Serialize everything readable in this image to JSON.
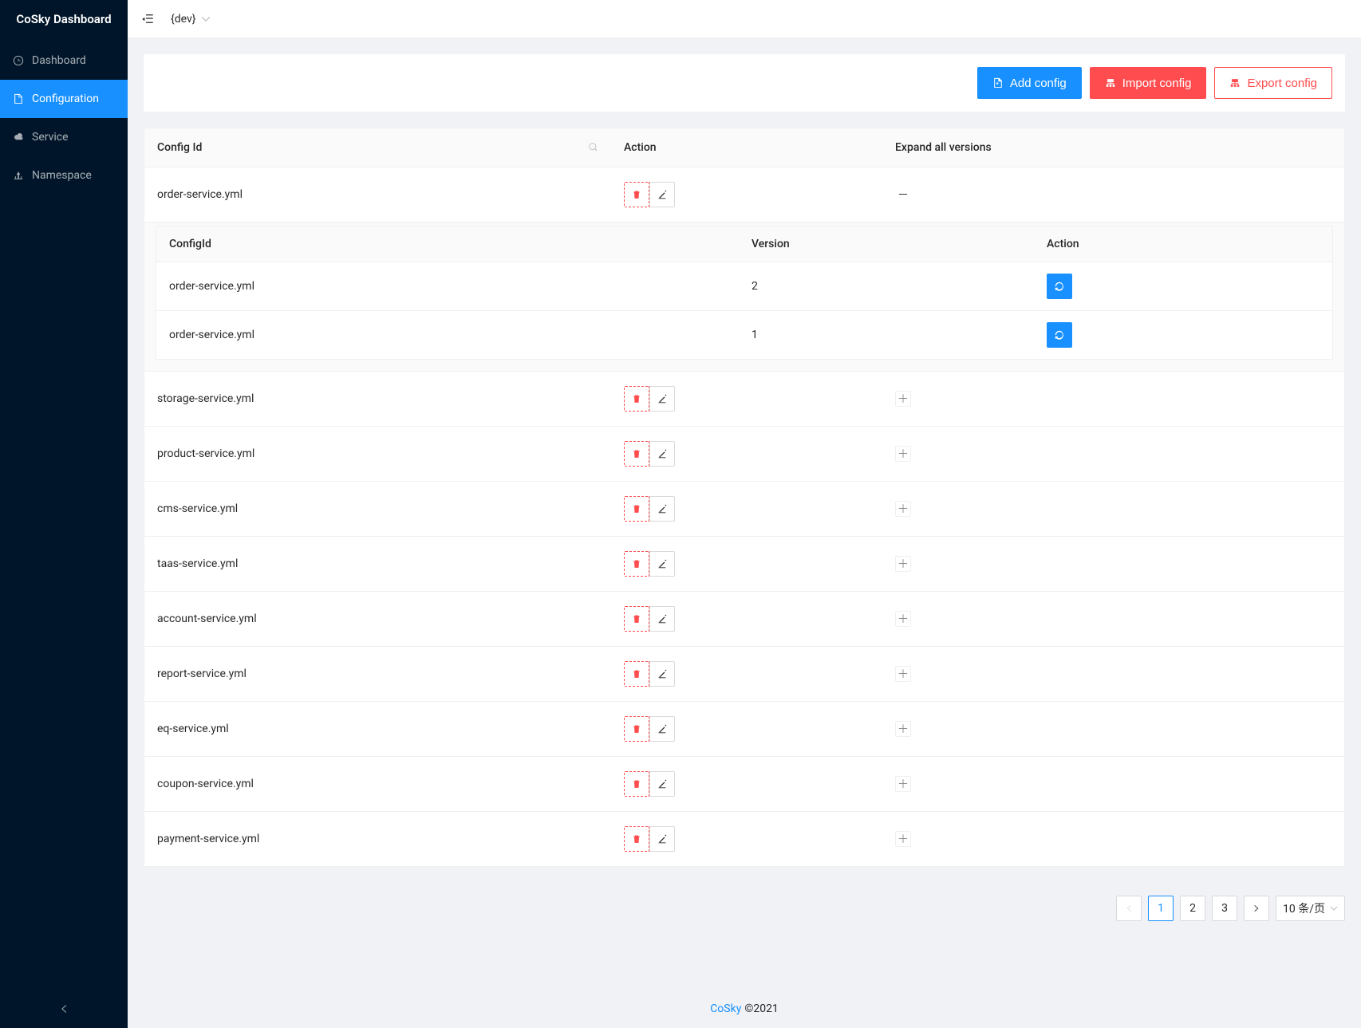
{
  "brand": "CoSky Dashboard",
  "sidebar": {
    "items": [
      {
        "icon": "dashboard",
        "label": "Dashboard"
      },
      {
        "icon": "file",
        "label": "Configuration"
      },
      {
        "icon": "cloud",
        "label": "Service"
      },
      {
        "icon": "deploy",
        "label": "Namespace"
      }
    ]
  },
  "header": {
    "namespace": "{dev}"
  },
  "toolbar": {
    "add_label": "Add config",
    "import_label": "Import config",
    "export_label": "Export config"
  },
  "table": {
    "cols": {
      "config_id": "Config Id",
      "action": "Action",
      "expand": "Expand all versions"
    },
    "rows": [
      {
        "id": "order-service.yml",
        "expanded": true
      },
      {
        "id": "storage-service.yml",
        "expanded": false
      },
      {
        "id": "product-service.yml",
        "expanded": false
      },
      {
        "id": "cms-service.yml",
        "expanded": false
      },
      {
        "id": "taas-service.yml",
        "expanded": false
      },
      {
        "id": "account-service.yml",
        "expanded": false
      },
      {
        "id": "report-service.yml",
        "expanded": false
      },
      {
        "id": "eq-service.yml",
        "expanded": false
      },
      {
        "id": "coupon-service.yml",
        "expanded": false
      },
      {
        "id": "payment-service.yml",
        "expanded": false
      }
    ],
    "nested": {
      "cols": {
        "config_id": "ConfigId",
        "version": "Version",
        "action": "Action"
      },
      "rows": [
        {
          "id": "order-service.yml",
          "version": "2"
        },
        {
          "id": "order-service.yml",
          "version": "1"
        }
      ]
    }
  },
  "pagination": {
    "pages": [
      "1",
      "2",
      "3"
    ],
    "active": 0,
    "size_label": "10 条/页"
  },
  "footer": {
    "link": "CoSky",
    "copyright": "©2021"
  }
}
